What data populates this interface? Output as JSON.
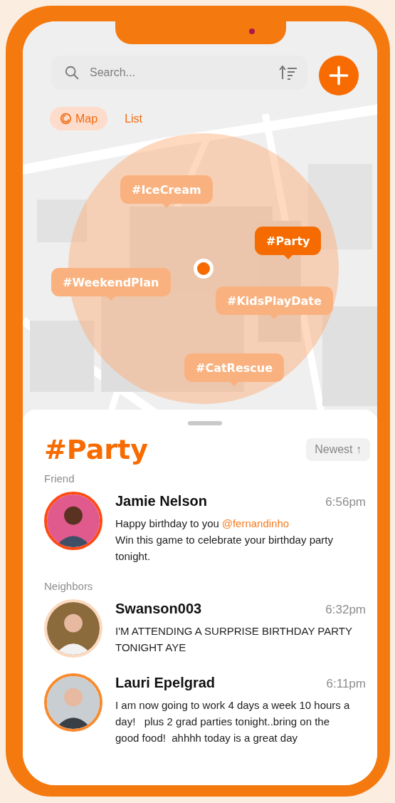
{
  "search": {
    "placeholder": "Search..."
  },
  "view_toggle": [
    {
      "label": "Map",
      "selected": true
    },
    {
      "label": "List",
      "selected": false
    }
  ],
  "map": {
    "kind": "picture",
    "tags": [
      {
        "label": "#IceCream",
        "selected": false
      },
      {
        "label": "#Party",
        "selected": true
      },
      {
        "label": "#WeekendPlan",
        "selected": false
      },
      {
        "label": "#KidsPlayDate",
        "selected": false
      },
      {
        "label": "#CatRescue",
        "selected": false
      }
    ]
  },
  "feed": {
    "title": "#Party",
    "sort": "Newest ↑",
    "sections": [
      {
        "label": "Friend",
        "posts": [
          {
            "name": "Jamie Nelson",
            "time": "6:56pm",
            "color": "#ff4a12",
            "text": "Happy birthday to you",
            "mention": "@fernandinho",
            "text_after": "Win this game to celebrate your birthday party tonight."
          }
        ]
      },
      {
        "label": "Neighbors",
        "posts": [
          {
            "name": "Swanson003",
            "time": "6:32pm",
            "color": "#fcd9bf",
            "text": "I'M ATTENDING A SURPRISE BIRTHDAY PARTY TONIGHT AYE"
          },
          {
            "name": "Lauri Epelgrad",
            "time": "6:11pm",
            "color": "#f98a2c",
            "text": "I am now going to work 4 days a week 10 hours a day!   plus 2 grad parties tonight..bring on the good food!  ahhhh today is a great day"
          }
        ]
      }
    ]
  }
}
